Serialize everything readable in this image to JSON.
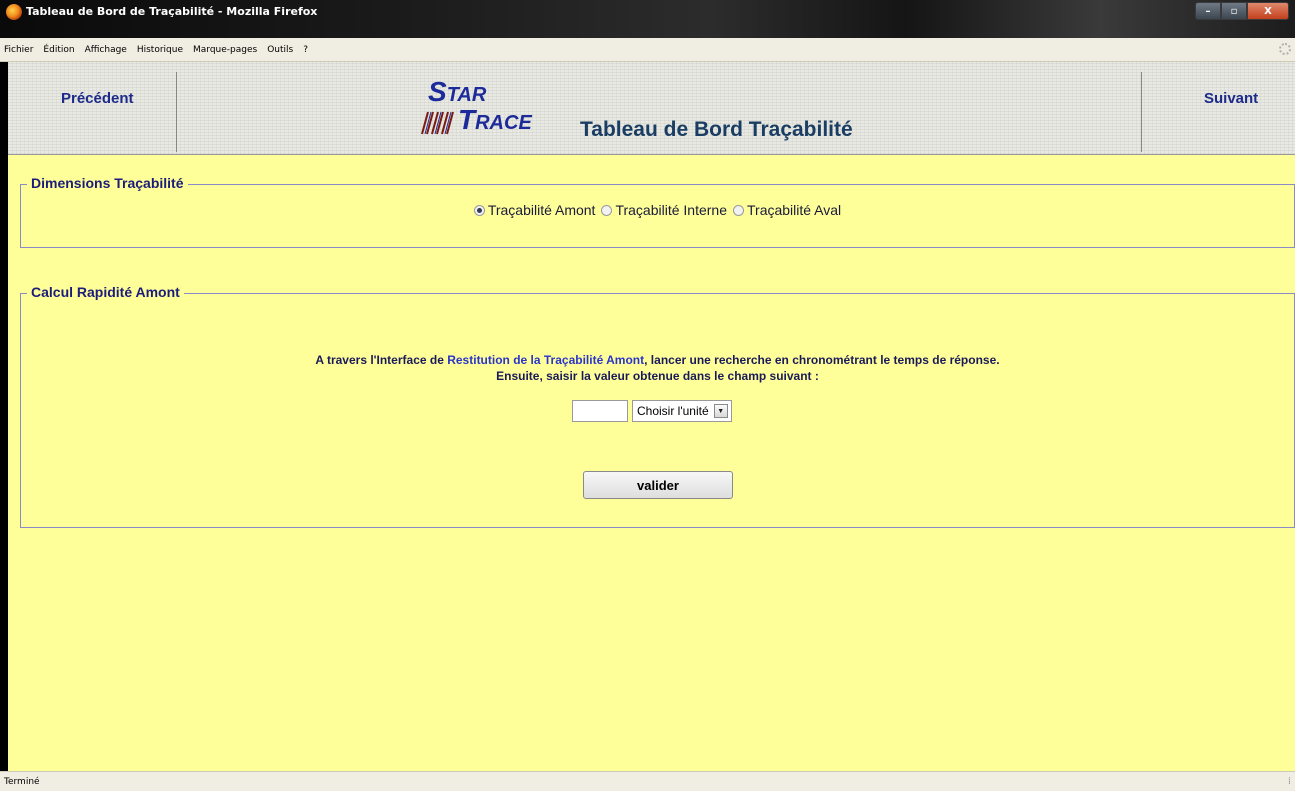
{
  "window": {
    "title": "Tableau de Bord de Traçabilité - Mozilla Firefox",
    "controls": {
      "minimize": "–",
      "maximize": "▫",
      "close": "X"
    }
  },
  "menu": [
    "Fichier",
    "Édition",
    "Affichage",
    "Historique",
    "Marque-pages",
    "Outils",
    "?"
  ],
  "header": {
    "prev_label": "Précédent",
    "next_label": "Suivant",
    "logo": {
      "star_first": "S",
      "star_rest": "TAR",
      "trace_first": "T",
      "trace_rest": "RACE"
    },
    "title": "Tableau de Bord Traçabilité"
  },
  "dimensions": {
    "legend": "Dimensions Traçabilité",
    "options": [
      {
        "label": "Traçabilité Amont",
        "selected": true
      },
      {
        "label": "Traçabilité Interne",
        "selected": false
      },
      {
        "label": "Traçabilité Aval",
        "selected": false
      }
    ]
  },
  "calcul": {
    "legend": "Calcul Rapidité Amont",
    "line1_before": "A travers l'Interface de ",
    "line1_link": "Restitution de la Traçabilité Amont",
    "line1_after": ", lancer une recherche en chronométrant le temps de réponse.",
    "line2": "Ensuite, saisir la valeur obtenue dans le champ suivant :",
    "input_value": "",
    "unit_select": "Choisir l'unité",
    "submit_label": "valider"
  },
  "status": {
    "text": "Terminé"
  },
  "colors": {
    "page_bg": "#ffff99",
    "accent": "#1c2a9a",
    "title": "#1a3d63"
  }
}
